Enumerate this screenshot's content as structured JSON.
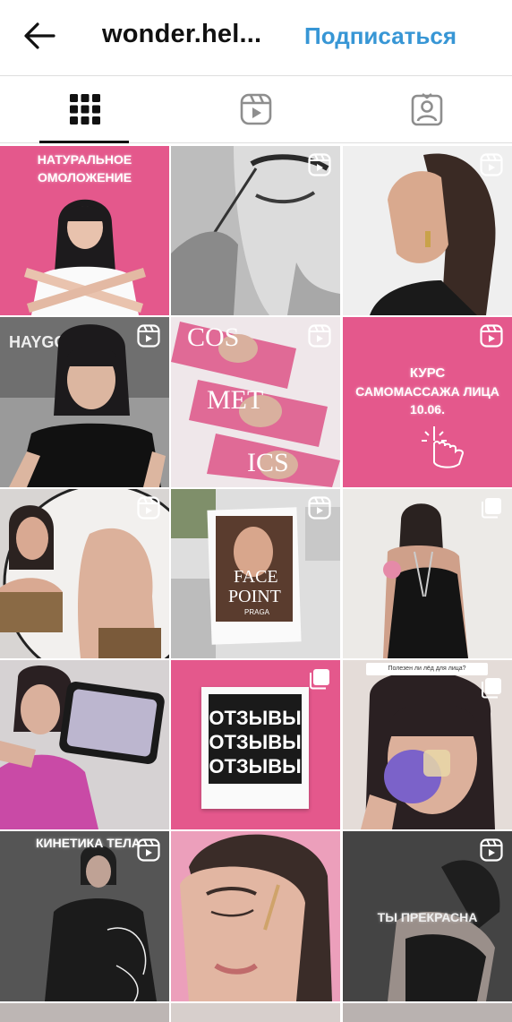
{
  "header": {
    "title": "wonder.hel...",
    "follow_label": "Подписаться"
  },
  "tabs": [
    {
      "name": "grid",
      "icon": "grid-icon"
    },
    {
      "name": "reels",
      "icon": "reels-icon"
    },
    {
      "name": "tagged",
      "icon": "tagged-icon"
    }
  ],
  "posts": [
    {
      "text1": "НАТУРАЛЬНОЕ",
      "text2": "ОМОЛОЖЕНИЕ",
      "badge": "none"
    },
    {
      "badge": "reel-icon"
    },
    {
      "badge": "reel-icon"
    },
    {
      "badge": "reel-icon",
      "sign": "HAYGO"
    },
    {
      "badge": "reel-icon",
      "cos1": "COS",
      "cos2": "MET",
      "cos3": "ICS"
    },
    {
      "badge": "reel-icon",
      "text1": "КУРС",
      "text2": "САМОМАССАЖА ЛИЦА",
      "text3": "10.06."
    },
    {
      "badge": "reel-icon"
    },
    {
      "badge": "reel-icon",
      "face1": "FACE",
      "face2": "POINT",
      "face3": "PRAGA"
    },
    {
      "badge": "carousel-icon"
    },
    {
      "badge": "none"
    },
    {
      "badge": "carousel-icon",
      "r1": "ОТЗЫВЫ",
      "r2": "ОТЗЫВЫ",
      "r3": "ОТЗЫВЫ"
    },
    {
      "badge": "carousel-icon",
      "poll": "Полезен ли лёд для лица?"
    },
    {
      "badge": "reel-icon",
      "text1": "КИНЕТИКА ТЕЛА"
    },
    {
      "badge": "none"
    },
    {
      "badge": "reel-icon",
      "text1": "ТЫ ПРЕКРАСНА"
    }
  ],
  "colors": {
    "accent": "#3796d5",
    "pink": "#e4588c"
  }
}
